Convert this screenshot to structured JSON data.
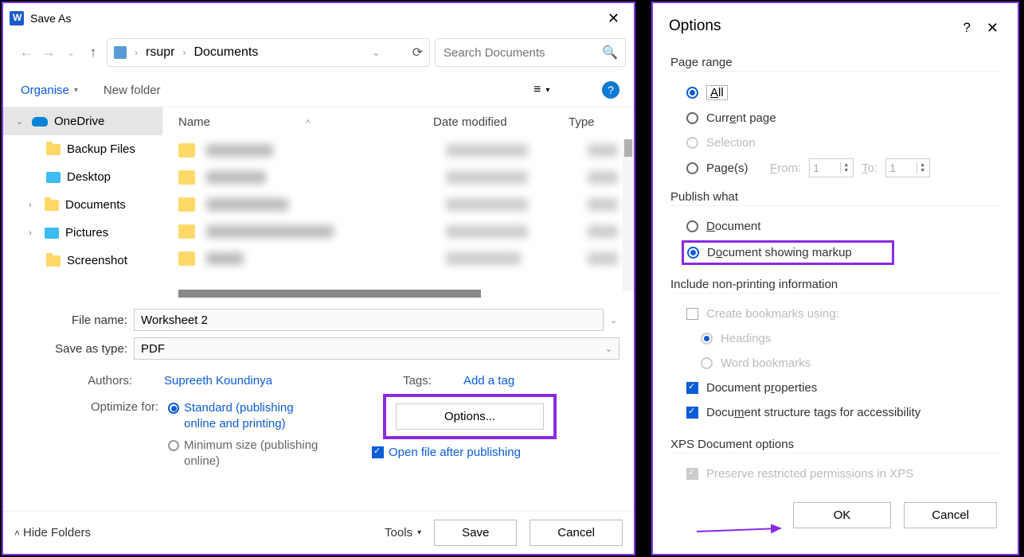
{
  "saveAs": {
    "title": "Save As",
    "path": {
      "user": "rsupr",
      "folder": "Documents"
    },
    "searchPlaceholder": "Search Documents",
    "organise": "Organise",
    "newFolder": "New folder",
    "tree": {
      "onedrive": "OneDrive",
      "backup": "Backup Files",
      "desktop": "Desktop",
      "documents": "Documents",
      "pictures": "Pictures",
      "screenshot": "Screenshot"
    },
    "columns": {
      "name": "Name",
      "date": "Date modified",
      "type": "Type"
    },
    "fileNameLabel": "File name:",
    "fileName": "Worksheet 2",
    "saveTypeLabel": "Save as type:",
    "saveType": "PDF",
    "authorsLabel": "Authors:",
    "authors": "Supreeth Koundinya",
    "tagsLabel": "Tags:",
    "tagsLink": "Add a tag",
    "optimizeLabel": "Optimize for:",
    "optStandard": "Standard (publishing online and printing)",
    "optMinimum": "Minimum size (publishing online)",
    "optionsBtn": "Options...",
    "openAfter": "Open file after publishing",
    "hideFolders": "Hide Folders",
    "tools": "Tools",
    "save": "Save",
    "cancel": "Cancel"
  },
  "options": {
    "title": "Options",
    "pageRange": "Page range",
    "all": "All",
    "currentPage": "Current page",
    "selection": "Selection",
    "pages": "Page(s)",
    "from": "From:",
    "fromVal": "1",
    "to": "To:",
    "toVal": "1",
    "publishWhat": "Publish what",
    "document": "Document",
    "documentMarkup": "Document showing markup",
    "includeNonPrint": "Include non-printing information",
    "createBookmarks": "Create bookmarks using:",
    "headings": "Headings",
    "wordBookmarks": "Word bookmarks",
    "docProps": "Document properties",
    "structTags": "Document structure tags for accessibility",
    "xpsOptions": "XPS Document options",
    "preserveXps": "Preserve restricted permissions in XPS",
    "ok": "OK",
    "cancel": "Cancel"
  }
}
